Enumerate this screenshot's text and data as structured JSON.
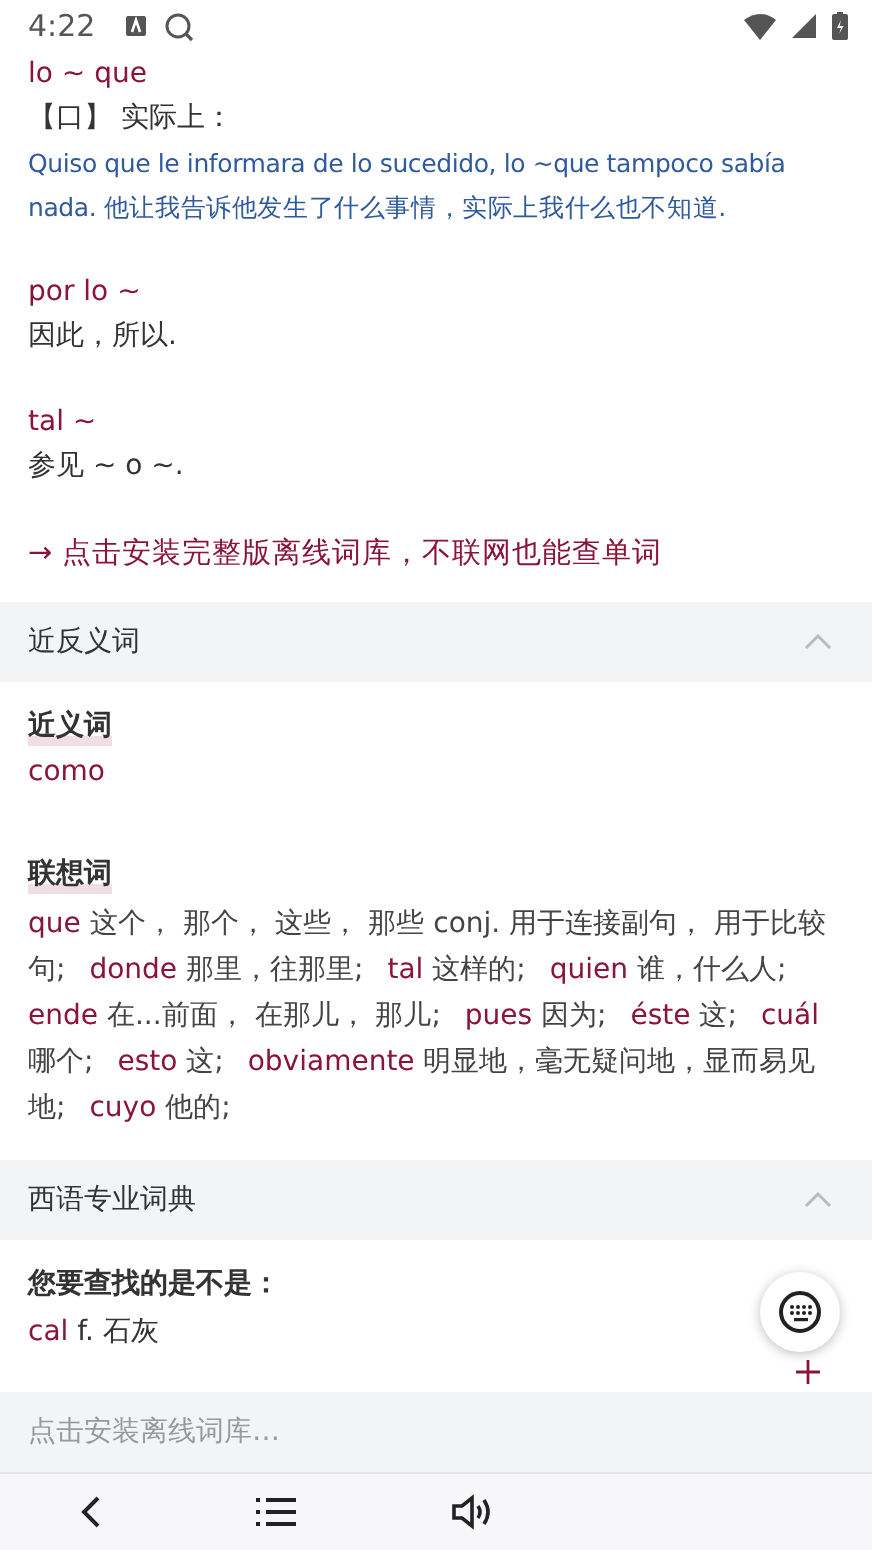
{
  "status_bar": {
    "time": "4:22"
  },
  "entries": [
    {
      "headword": "lo ~ que",
      "sense": "【口】 实际上：",
      "example": "Quiso que le informara de lo sucedido, lo ~que tampoco sabía nada. 他让我告诉他发生了什么事情，实际上我什么也不知道."
    },
    {
      "headword": "por lo ~",
      "sense": "因此，所以."
    },
    {
      "headword": "tal ~",
      "sense": "参见 ~ o ~."
    }
  ],
  "install_link": "→ 点击安装完整版离线词库，不联网也能查单词",
  "related_section": {
    "title": "近反义词",
    "expanded": true,
    "synonyms": {
      "heading": "近义词",
      "words": [
        "como"
      ]
    },
    "associations": {
      "heading": "联想词",
      "items": [
        {
          "word": "que",
          "gloss": "这个， 那个， 这些， 那些 conj. 用于连接副句， 用于比较句;"
        },
        {
          "word": "donde",
          "gloss": "那里，往那里;"
        },
        {
          "word": "tal",
          "gloss": "这样的;"
        },
        {
          "word": "quien",
          "gloss": "谁，什么人;"
        },
        {
          "word": "ende",
          "gloss": "在...前面， 在那儿， 那儿;"
        },
        {
          "word": "pues",
          "gloss": "因为;"
        },
        {
          "word": "éste",
          "gloss": "这;"
        },
        {
          "word": "cuál",
          "gloss": "哪个;"
        },
        {
          "word": "esto",
          "gloss": "这;"
        },
        {
          "word": "obviamente",
          "gloss": "明显地，毫无疑问地，显而易见地;"
        },
        {
          "word": "cuyo",
          "gloss": "他的;"
        }
      ]
    }
  },
  "pro_section": {
    "title": "西语专业词典",
    "expanded": true,
    "heading": "您要查找的是不是：",
    "items": [
      {
        "word": "cal",
        "gloss": "f. 石灰"
      }
    ]
  },
  "search_bar": {
    "placeholder": "点击安装离线词库…"
  }
}
